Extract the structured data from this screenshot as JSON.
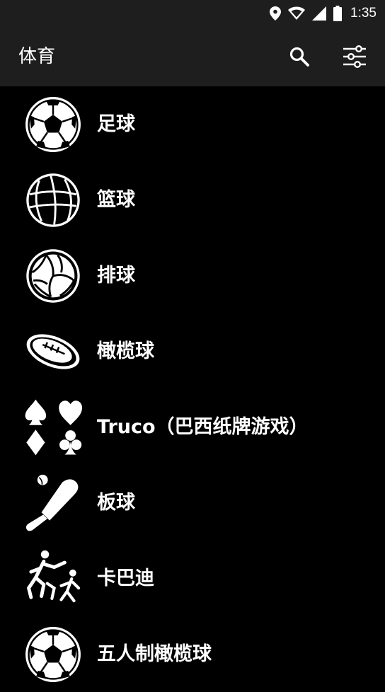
{
  "status_bar": {
    "time": "1:35",
    "icons": [
      "location-icon",
      "wifi-icon",
      "signal-icon",
      "battery-icon"
    ]
  },
  "app_bar": {
    "title": "体育",
    "actions": [
      "search-icon",
      "filter-icon"
    ]
  },
  "sports": [
    {
      "label": "足球",
      "icon": "soccer-ball-icon"
    },
    {
      "label": "篮球",
      "icon": "basketball-icon"
    },
    {
      "label": "排球",
      "icon": "volleyball-icon"
    },
    {
      "label": "橄榄球",
      "icon": "rugby-ball-icon"
    },
    {
      "label": "Truco（巴西纸牌游戏）",
      "icon": "card-suits-icon"
    },
    {
      "label": "板球",
      "icon": "cricket-bat-icon"
    },
    {
      "label": "卡巴迪",
      "icon": "kabaddi-players-icon"
    },
    {
      "label": "五人制橄榄球",
      "icon": "soccer-ball-icon"
    }
  ],
  "colors": {
    "background": "#000000",
    "app_bar": "#1e1e1e",
    "text": "#ffffff"
  }
}
